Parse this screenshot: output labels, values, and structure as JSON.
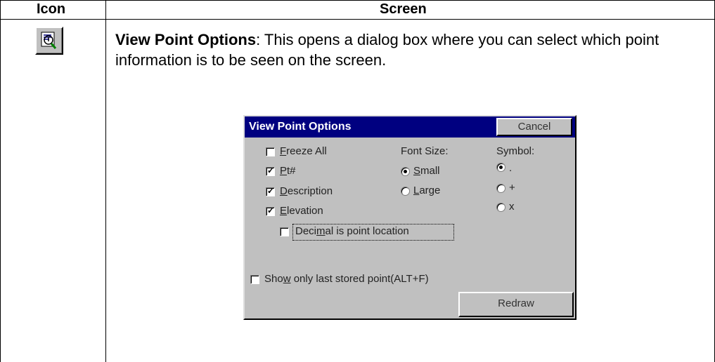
{
  "table": {
    "headers": [
      "Icon",
      "Screen"
    ]
  },
  "row": {
    "icon_name": "view-point-options-icon",
    "description_title": "View Point Options",
    "description_text": ": This opens a dialog box where you can select which point information is to be seen on the screen."
  },
  "dialog": {
    "title": "View Point Options",
    "cancel_label": "Cancel",
    "checkboxes": [
      {
        "label": "Freeze All",
        "checked": false,
        "accel": "F"
      },
      {
        "label": "Pt#",
        "checked": true,
        "accel": "P"
      },
      {
        "label": "Description",
        "checked": true,
        "accel": "D"
      },
      {
        "label": "Elevation",
        "checked": true,
        "accel": "E"
      }
    ],
    "decimal_checkbox": {
      "label": "Decimal is point location",
      "checked": false
    },
    "font_size": {
      "label": "Font Size:",
      "options": [
        {
          "label": "Small",
          "selected": true
        },
        {
          "label": "Large",
          "selected": false
        }
      ]
    },
    "symbol": {
      "label": "Symbol:",
      "options": [
        {
          "label": ".",
          "selected": true
        },
        {
          "label": "+",
          "selected": false
        },
        {
          "label": "x",
          "selected": false
        }
      ]
    },
    "show_last_checkbox": {
      "label": "Show only last stored point(ALT+F)",
      "checked": false
    },
    "redraw_label": "Redraw"
  }
}
